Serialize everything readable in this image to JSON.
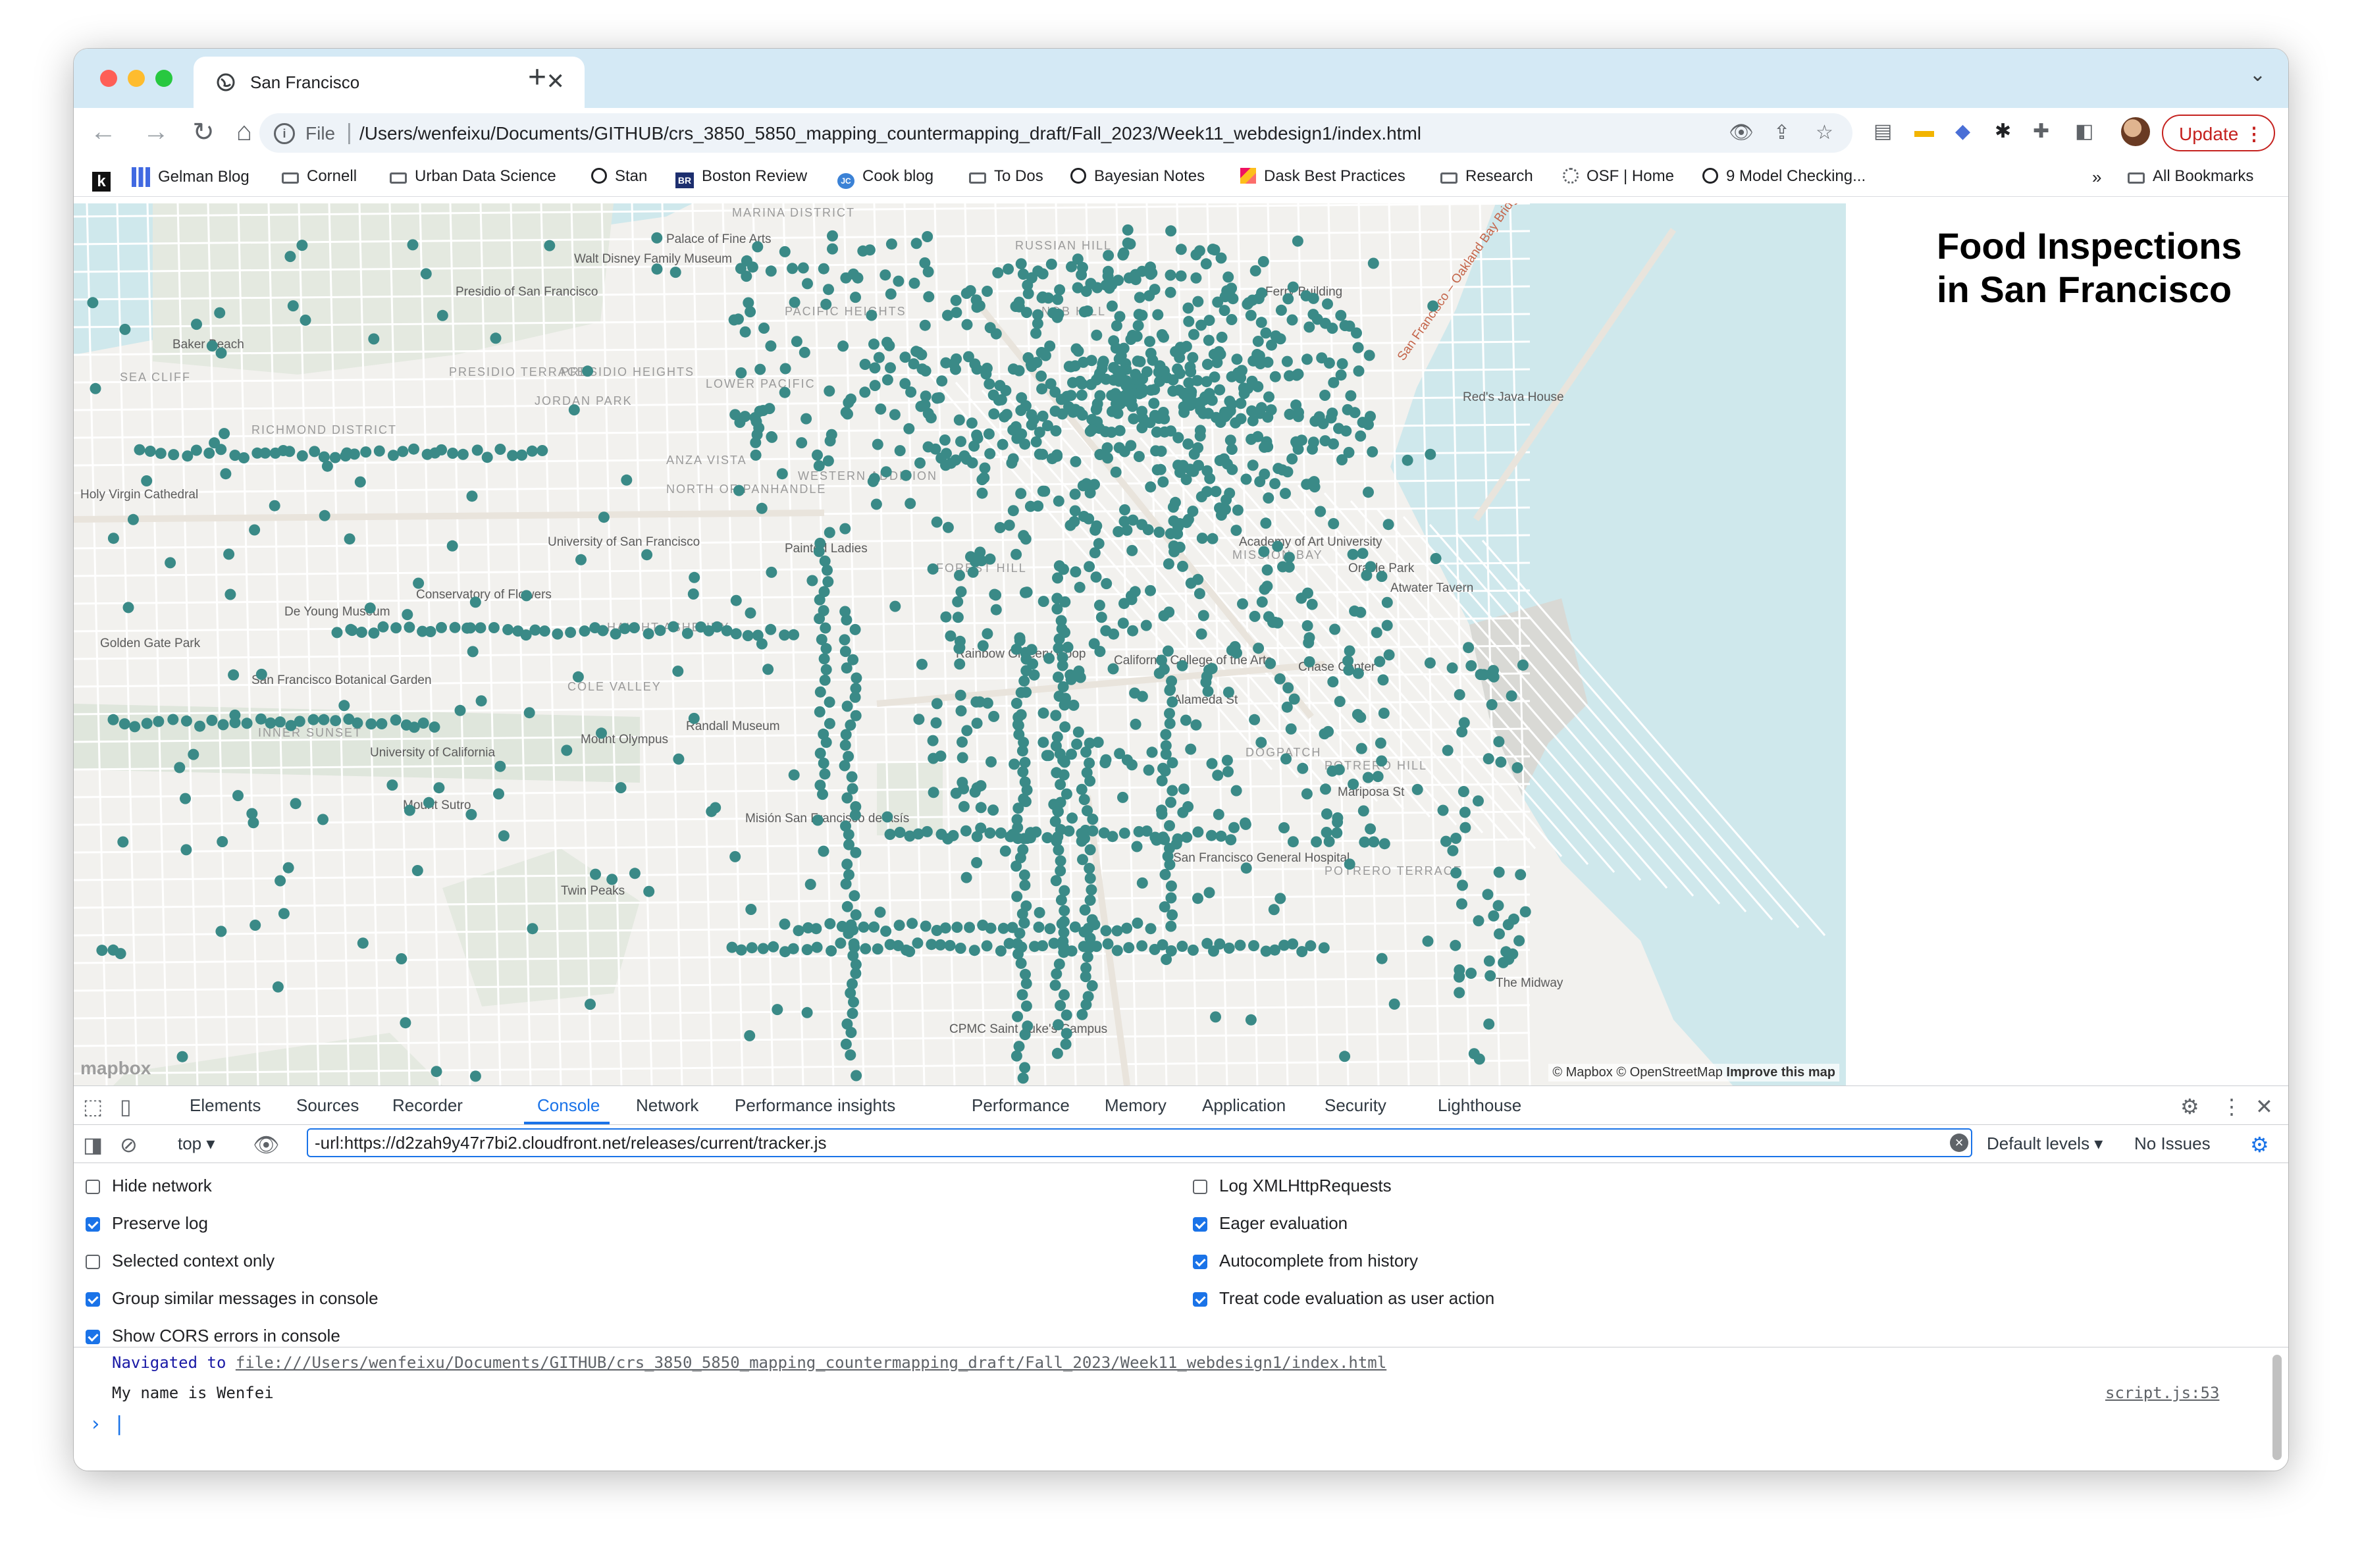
{
  "browser": {
    "tab": {
      "title": "San Francisco",
      "close": "✕"
    },
    "new_tab": "+",
    "tab_search": "⌄",
    "omnibox": {
      "scheme": "File",
      "separator": "|",
      "url": "/Users/wenfeixu/Documents/GITHUB/crs_3850_5850_mapping_countermapping_draft/Fall_2023/Week11_webdesign1/index.html"
    },
    "nav": {
      "back": "←",
      "forward": "→",
      "reload": "↻",
      "home": "⌂"
    },
    "update_button": {
      "label": "Update",
      "menu": "⋮"
    },
    "bookmarks": [
      {
        "label": "",
        "icon": "k-logo-icon"
      },
      {
        "label": "Gelman Blog",
        "icon": "bar-chart-icon"
      },
      {
        "label": "Cornell",
        "icon": "folder-icon"
      },
      {
        "label": "Urban Data Science",
        "icon": "folder-icon"
      },
      {
        "label": "Stan",
        "icon": "globe-icon"
      },
      {
        "label": "Boston Review",
        "icon": "br-logo-icon"
      },
      {
        "label": "Cook blog",
        "icon": "jc-logo-icon"
      },
      {
        "label": "To Dos",
        "icon": "folder-icon"
      },
      {
        "label": "Bayesian Notes",
        "icon": "globe-icon"
      },
      {
        "label": "Dask Best Practices",
        "icon": "dask-logo-icon"
      },
      {
        "label": "Research",
        "icon": "folder-icon"
      },
      {
        "label": "OSF | Home",
        "icon": "osf-logo-icon"
      },
      {
        "label": "9 Model Checking...",
        "icon": "globe-icon"
      }
    ],
    "bookmarks_overflow": "»",
    "all_bookmarks": "All Bookmarks"
  },
  "page": {
    "title": "Food Inspections in San Francisco",
    "map": {
      "marker_color": "#3a8a87",
      "attribution": {
        "mapbox": "© Mapbox",
        "osm": "© OpenStreetMap",
        "improve": "Improve this map"
      },
      "logo": "mapbox",
      "labels": [
        "Palace of Fine Arts",
        "Walt Disney Family Museum",
        "Presidio of San Francisco",
        "Baker Beach",
        "SEA CLIFF",
        "PRESIDIO TERRACE",
        "PRESIDIO HEIGHTS",
        "JORDAN PARK",
        "RICHMOND DISTRICT",
        "Holy Virgin Cathedral",
        "ANZA VISTA",
        "NORTH OF PANHANDLE",
        "WESTERN ADDITION",
        "Painted Ladies",
        "University of San Francisco",
        "Conservatory of Flowers",
        "De Young Museum",
        "Golden Gate Park",
        "San Francisco Botanical Garden",
        "HAIGHT ASHBURY",
        "COLE VALLEY",
        "INNER SUNSET",
        "University of California",
        "Mount Olympus",
        "Randall Museum",
        "Mount Sutro",
        "Twin Peaks",
        "FOREST HILL",
        "Misión San Francisco de Asís",
        "Rainbow Grocery Coop",
        "California College of the Arts",
        "Alameda St",
        "Mariposa St",
        "Chase Center",
        "MISSION BAY",
        "DOGPATCH",
        "POTRERO HILL",
        "POTRERO TERRACE",
        "San Francisco General Hospital",
        "The Midway",
        "CPMC Saint Luke's Campus",
        "Oracle Park",
        "Atwater Tavern",
        "Academy of Art University",
        "Red's Java House",
        "MARINA DISTRICT",
        "RUSSIAN HILL",
        "NOB HILL",
        "PACIFIC HEIGHTS",
        "LOWER PACIFIC",
        "San Francisco – Oakland Bay Bridge",
        "Ferry Building"
      ]
    }
  },
  "devtools": {
    "tabs": [
      "Elements",
      "Sources",
      "Recorder",
      "Console",
      "Network",
      "Performance insights",
      "Performance",
      "Memory",
      "Application",
      "Security",
      "Lighthouse"
    ],
    "active_tab": "Console",
    "context": "top",
    "filter_value": "-url:https://d2zah9y47r7bi2.cloudfront.net/releases/current/tracker.js",
    "levels": "Default levels",
    "issues": "No Issues",
    "settings_left": [
      {
        "label": "Hide network",
        "checked": false
      },
      {
        "label": "Preserve log",
        "checked": true
      },
      {
        "label": "Selected context only",
        "checked": false
      },
      {
        "label": "Group similar messages in console",
        "checked": true
      },
      {
        "label": "Show CORS errors in console",
        "checked": true
      }
    ],
    "settings_right": [
      {
        "label": "Log XMLHttpRequests",
        "checked": false
      },
      {
        "label": "Eager evaluation",
        "checked": true
      },
      {
        "label": "Autocomplete from history",
        "checked": true
      },
      {
        "label": "Treat code evaluation as user action",
        "checked": true
      }
    ],
    "console": {
      "navigated_prefix": "Navigated to",
      "navigated_url": "file:///Users/wenfeixu/Documents/GITHUB/crs_3850_5850_mapping_countermapping_draft/Fall_2023/Week11_webdesign1/index.html",
      "log_message": "My name is Wenfei",
      "log_source": "script.js:53",
      "prompt": "›"
    }
  }
}
